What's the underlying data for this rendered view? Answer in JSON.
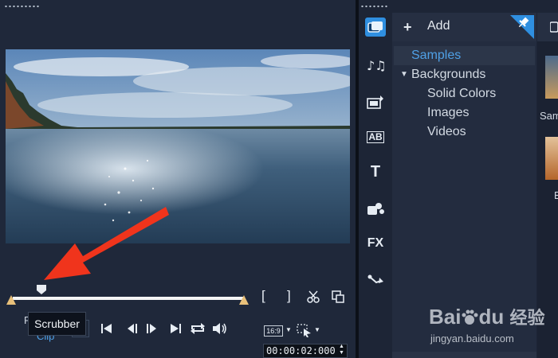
{
  "tooltip": {
    "text": "Scrubber"
  },
  "preview": {
    "project_label": "P",
    "clip_label": "Clip",
    "aspect_ratio": "16:9",
    "timecode": "00:00:02:000"
  },
  "library": {
    "add_label": "Add",
    "tree": [
      {
        "label": "Samples",
        "selected": true,
        "level": 0
      },
      {
        "label": "Backgrounds",
        "expanded": true,
        "level": 0
      },
      {
        "label": "Solid Colors",
        "level": 1
      },
      {
        "label": "Images",
        "level": 1
      },
      {
        "label": "Videos",
        "level": 1
      }
    ],
    "thumb_labels": [
      "Sam",
      "B"
    ],
    "side_icons": [
      "media-icon",
      "audio-icon",
      "instant-project-icon",
      "transition-icon",
      "title-icon",
      "graphics-icon",
      "fx-icon",
      "path-icon"
    ],
    "fx_label": "FX",
    "transition_label": "AB",
    "title_label": "T"
  },
  "watermark": {
    "brand": "Bai",
    "brand_suffix": "du",
    "cn": "经验",
    "url": "jingyan.baidu.com"
  },
  "colors": {
    "accent_blue": "#4fa0e6",
    "trim_handle": "#e8c07a",
    "arrow": "#f0341c",
    "pin_bg": "#2f8fe0"
  }
}
